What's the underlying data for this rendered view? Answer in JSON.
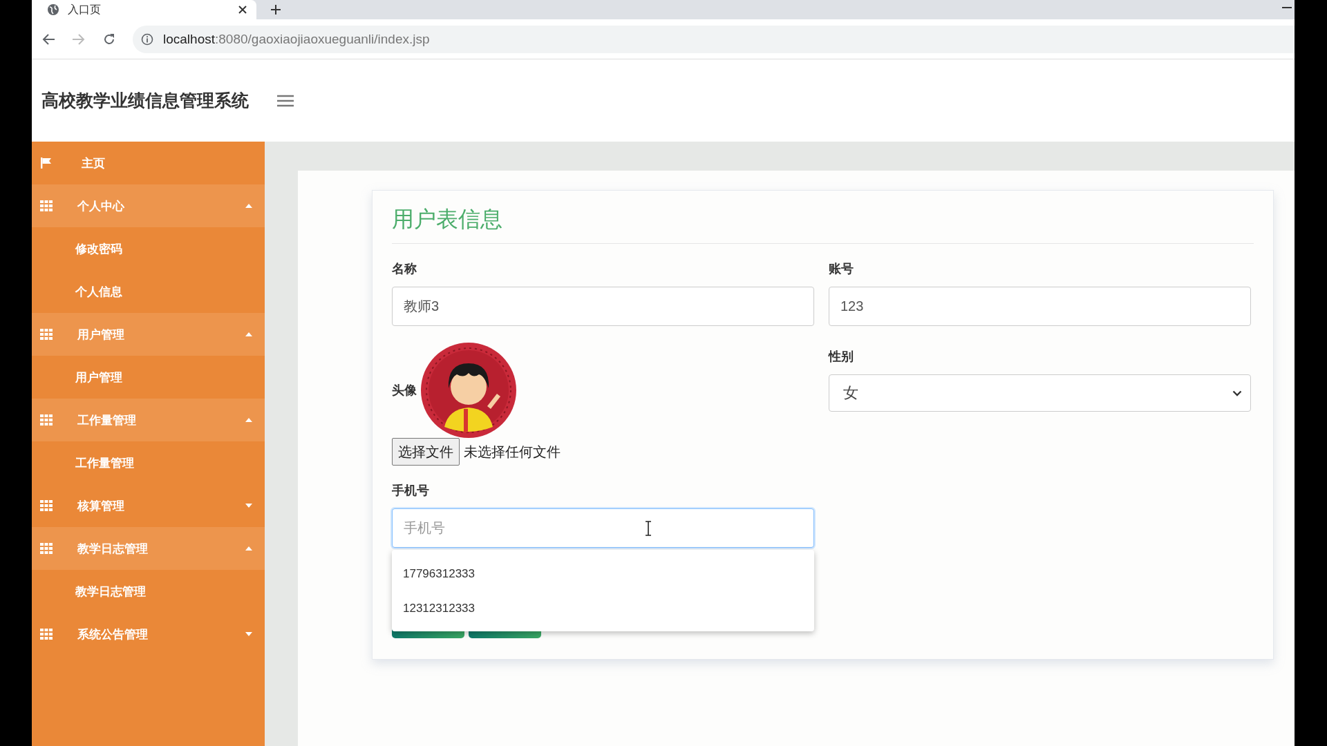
{
  "browser": {
    "tab": {
      "title": "入口页"
    },
    "url": {
      "host": "localhost",
      "path": ":8080/gaoxiaojiaoxueguanli/index.jsp"
    }
  },
  "header": {
    "title": "高校教学业绩信息管理系统"
  },
  "sidebar": {
    "items": [
      {
        "kind": "link",
        "label": "主页"
      },
      {
        "kind": "group",
        "label": "个人中心",
        "expanded": true,
        "children": [
          {
            "label": "修改密码"
          },
          {
            "label": "个人信息"
          }
        ]
      },
      {
        "kind": "group",
        "label": "用户管理",
        "expanded": true,
        "children": [
          {
            "label": "用户管理"
          }
        ]
      },
      {
        "kind": "group",
        "label": "工作量管理",
        "expanded": true,
        "children": [
          {
            "label": "工作量管理"
          }
        ]
      },
      {
        "kind": "group",
        "label": "核算管理",
        "expanded": false
      },
      {
        "kind": "group",
        "label": "教学日志管理",
        "expanded": true,
        "children": [
          {
            "label": "教学日志管理"
          }
        ]
      },
      {
        "kind": "group",
        "label": "系统公告管理",
        "expanded": false
      }
    ]
  },
  "form": {
    "title": "用户表信息",
    "columns": [
      {
        "fields": [
          {
            "kind": "text",
            "label": "名称",
            "value": "教师3"
          },
          {
            "label": "头像",
            "file_button": "选择文件",
            "file_status": "未选择任何文件"
          },
          {
            "kind": "text",
            "label": "手机号",
            "placeholder": "手机号",
            "focused": true,
            "suggestions": [
              "17796312333",
              "12312312333"
            ]
          }
        ]
      },
      {
        "fields": [
          {
            "kind": "text",
            "label": "账号",
            "value": "123"
          },
          {
            "kind": "select",
            "label": "性别",
            "value": "女"
          }
        ]
      }
    ],
    "buttons": [
      {
        "kind": "button"
      },
      {
        "kind": "button"
      }
    ]
  }
}
